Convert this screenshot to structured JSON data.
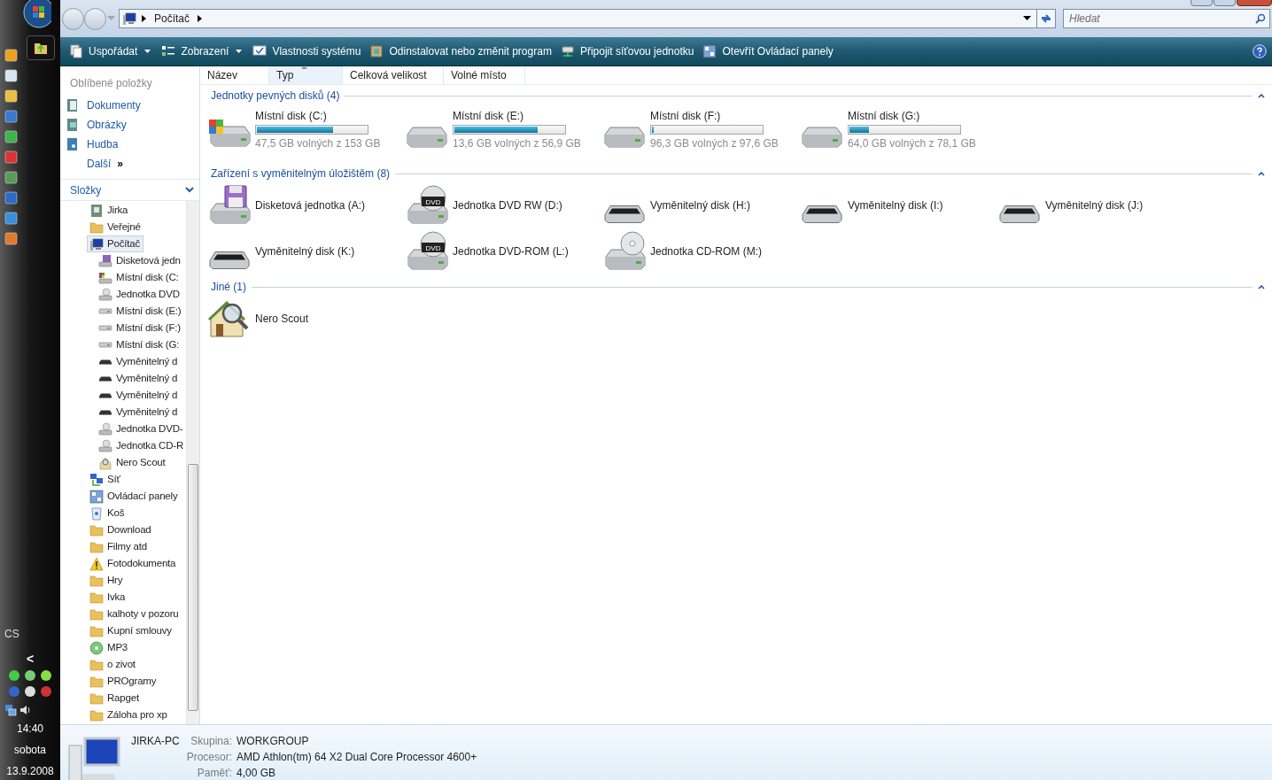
{
  "taskbar": {
    "language": "CS",
    "collapse": "<",
    "time": "14:40",
    "day": "sobota",
    "date": "13.9.2008"
  },
  "address": {
    "path": "Počítač",
    "search_placeholder": "Hledat"
  },
  "toolbar": [
    {
      "label": "Uspořádat",
      "kind": "organize",
      "menu": true
    },
    {
      "label": "Zobrazení",
      "kind": "views",
      "menu": true
    },
    {
      "label": "Vlastnosti systému",
      "kind": "system",
      "menu": false
    },
    {
      "label": "Odinstalovat nebo změnit program",
      "kind": "programs",
      "menu": false
    },
    {
      "label": "Připojit síťovou jednotku",
      "kind": "network-drive",
      "menu": false
    },
    {
      "label": "Otevřít Ovládací panely",
      "kind": "control-panel",
      "menu": false
    }
  ],
  "favorites": {
    "title": "Oblíbené položky",
    "items": [
      {
        "label": "Dokumenty",
        "kind": "documents"
      },
      {
        "label": "Obrázky",
        "kind": "pictures"
      },
      {
        "label": "Hudba",
        "kind": "music"
      }
    ],
    "more": "Další",
    "more_mark": "»"
  },
  "folders": {
    "title": "Složky",
    "tree": [
      {
        "label": "Jirka",
        "kind": "user",
        "selected": false
      },
      {
        "label": "Veřejné",
        "kind": "folder",
        "selected": false
      },
      {
        "label": "Počítač",
        "kind": "computer",
        "selected": true,
        "children": [
          {
            "label": "Disketová jedn",
            "kind": "floppy",
            "selected": false
          },
          {
            "label": "Místní disk (C:",
            "kind": "system-disk",
            "selected": false
          },
          {
            "label": "Jednotka DVD",
            "kind": "optical",
            "selected": false
          },
          {
            "label": "Místní disk (E:)",
            "kind": "disk",
            "selected": false
          },
          {
            "label": "Místní disk (F:)",
            "kind": "disk",
            "selected": false
          },
          {
            "label": "Místní disk (G:",
            "kind": "disk",
            "selected": false
          },
          {
            "label": "Vyměnitelný d",
            "kind": "removable",
            "selected": false
          },
          {
            "label": "Vyměnitelný d",
            "kind": "removable",
            "selected": false
          },
          {
            "label": "Vyměnitelný d",
            "kind": "removable",
            "selected": false
          },
          {
            "label": "Vyměnitelný d",
            "kind": "removable",
            "selected": false
          },
          {
            "label": "Jednotka DVD-",
            "kind": "optical",
            "selected": false
          },
          {
            "label": "Jednotka CD-R",
            "kind": "optical",
            "selected": false
          },
          {
            "label": "Nero Scout",
            "kind": "app",
            "selected": false
          }
        ]
      },
      {
        "label": "Síť",
        "kind": "network",
        "selected": false
      },
      {
        "label": "Ovládací panely",
        "kind": "control-panel",
        "selected": false
      },
      {
        "label": "Koš",
        "kind": "recycle",
        "selected": false
      },
      {
        "label": "Download",
        "kind": "folder",
        "selected": false
      },
      {
        "label": "Filmy atd",
        "kind": "folder",
        "selected": false
      },
      {
        "label": "Fotodokumenta",
        "kind": "warning",
        "selected": false
      },
      {
        "label": "Hry",
        "kind": "folder",
        "selected": false
      },
      {
        "label": "Ivka",
        "kind": "folder",
        "selected": false
      },
      {
        "label": "kalhoty v pozoru",
        "kind": "folder",
        "selected": false
      },
      {
        "label": "Kupní smlouvy",
        "kind": "folder",
        "selected": false
      },
      {
        "label": "MP3",
        "kind": "music-cd",
        "selected": false
      },
      {
        "label": "o zivot",
        "kind": "folder",
        "selected": false
      },
      {
        "label": "PROgramy",
        "kind": "folder",
        "selected": false
      },
      {
        "label": "Rapget",
        "kind": "folder",
        "selected": false
      },
      {
        "label": "Záloha pro xp",
        "kind": "folder",
        "selected": false
      }
    ]
  },
  "columns": [
    {
      "label": "Název",
      "sorted": false
    },
    {
      "label": "Typ",
      "sorted": true
    },
    {
      "label": "Celková velikost",
      "sorted": false
    },
    {
      "label": "Volné místo",
      "sorted": false
    }
  ],
  "groups": [
    {
      "title": "Jednotky pevných disků (4)",
      "items": [
        {
          "kind": "system-disk",
          "name": "Místní disk (C:)",
          "level": 0.69,
          "free": "47,5 GB volných z 153 GB"
        },
        {
          "kind": "disk",
          "name": "Místní disk (E:)",
          "level": 0.76,
          "free": "13,6 GB volných z 56,9 GB"
        },
        {
          "kind": "disk",
          "name": "Místní disk (F:)",
          "level": 0.02,
          "free": "96,3 GB volných z 97,6 GB"
        },
        {
          "kind": "disk",
          "name": "Místní disk (G:)",
          "level": 0.18,
          "free": "64,0 GB volných z 78,1 GB"
        }
      ]
    },
    {
      "title": "Zařízení s vyměnitelným úložištěm (8)",
      "items": [
        {
          "kind": "floppy",
          "name": "Disketová jednotka (A:)"
        },
        {
          "kind": "dvd",
          "name": "Jednotka DVD RW (D:)",
          "badge": "DVD"
        },
        {
          "kind": "removable",
          "name": "Vyměnitelný disk (H:)"
        },
        {
          "kind": "removable",
          "name": "Vyměnitelný disk (I:)"
        },
        {
          "kind": "removable",
          "name": "Vyměnitelný disk (J:)"
        },
        {
          "kind": "removable",
          "name": "Vyměnitelný disk (K:)"
        },
        {
          "kind": "dvd",
          "name": "Jednotka DVD-ROM (L:)",
          "badge": "DVD"
        },
        {
          "kind": "cd",
          "name": "Jednotka CD-ROM (M:)"
        }
      ]
    },
    {
      "title": "Jiné (1)",
      "items": [
        {
          "kind": "app",
          "name": "Nero Scout"
        }
      ]
    }
  ],
  "details": {
    "name": "JIRKA-PC",
    "fields": [
      {
        "label": "Skupina:",
        "value": "WORKGROUP"
      },
      {
        "label": "Procesor:",
        "value": "AMD Athlon(tm) 64 X2 Dual Core Processor 4600+"
      },
      {
        "label": "Paměť:",
        "value": "4,00 GB"
      }
    ]
  }
}
